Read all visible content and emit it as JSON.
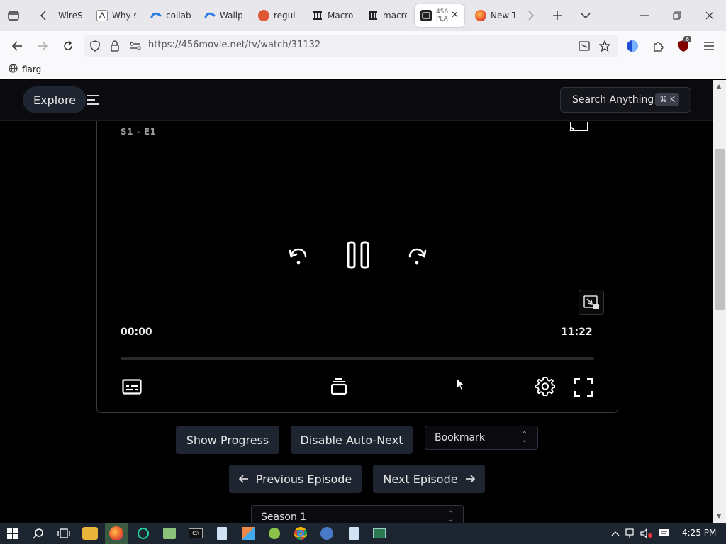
{
  "browser": {
    "tabs": [
      {
        "title": "WireS",
        "icon": "wireshark-icon"
      },
      {
        "title": "Why s",
        "icon": "document-icon"
      },
      {
        "title": "collab",
        "icon": "swirl-icon"
      },
      {
        "title": "Wallp",
        "icon": "swirl-icon"
      },
      {
        "title": "regul",
        "icon": "duckduckgo-icon"
      },
      {
        "title": "Macro",
        "icon": "building-icon"
      },
      {
        "title": "macro",
        "icon": "building-icon"
      },
      {
        "title": "456",
        "subtitle": "PLA",
        "icon": "film-icon",
        "active": true
      },
      {
        "title": "New T",
        "icon": "firefox-icon"
      }
    ],
    "url": "https://456movie.net/tv/watch/31132",
    "bookmarks": [
      {
        "label": "flarg",
        "icon": "globe-icon"
      }
    ],
    "extension_badge": "6"
  },
  "page": {
    "nav": {
      "explore_label": "Explore",
      "search_label": "Search Anything",
      "search_shortcut": "⌘ K"
    },
    "player": {
      "episode_label": "S1 - E1",
      "current_time": "00:00",
      "duration": "11:22",
      "progress": 0
    },
    "buttons": {
      "show_progress": "Show Progress",
      "disable_auto_next": "Disable Auto-Next",
      "previous_episode": "Previous Episode",
      "next_episode": "Next Episode"
    },
    "selects": {
      "bookmark": "Bookmark",
      "season": "Season 1"
    }
  },
  "taskbar": {
    "time": "4:25 PM"
  },
  "colors": {
    "button_bg": "#1e2430",
    "page_bg": "#000000",
    "text": "#e6e6e6"
  }
}
